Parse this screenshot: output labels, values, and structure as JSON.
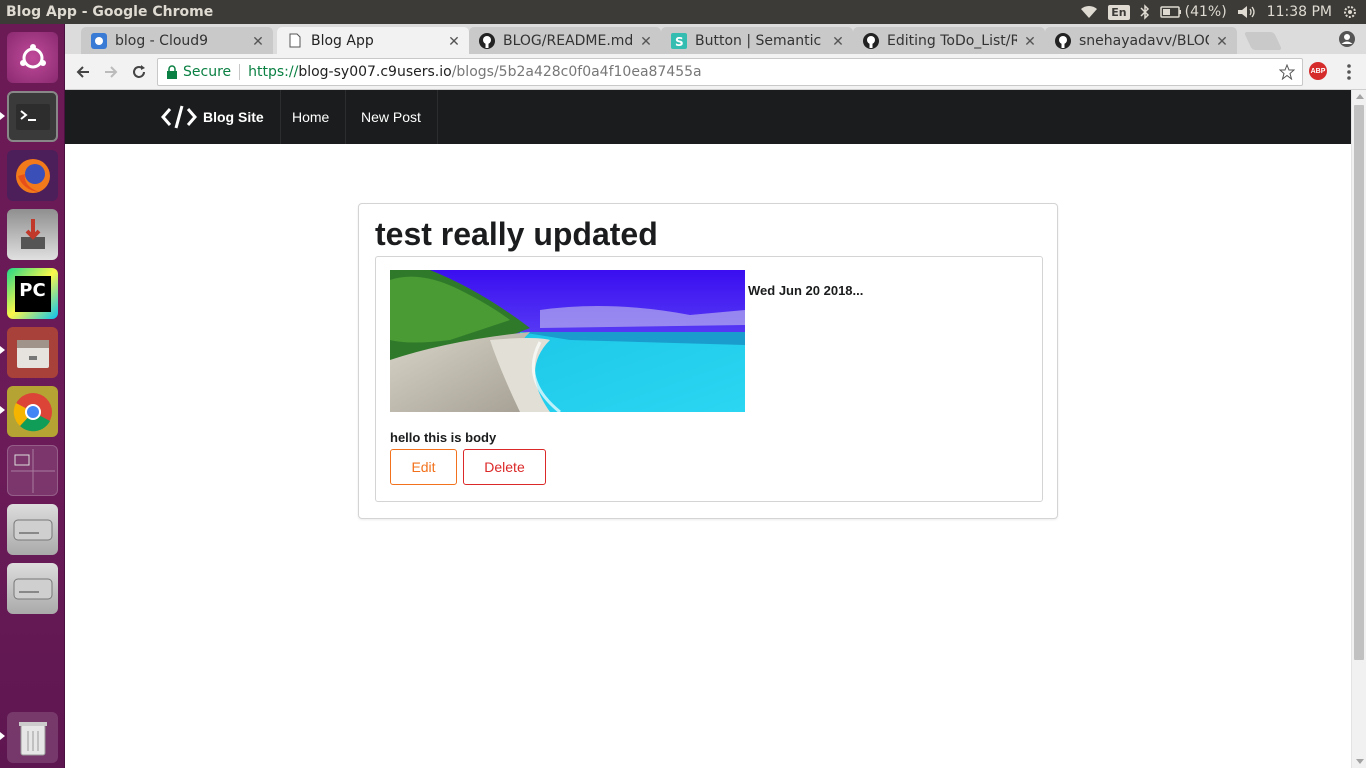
{
  "os": {
    "window_title": "Blog App - Google Chrome",
    "keyboard_layout": "En",
    "battery": "(41%)",
    "clock": "11:38 PM",
    "launcher_items": [
      "ubuntu-home",
      "terminal",
      "firefox",
      "installer",
      "pycharm",
      "files",
      "chrome",
      "workspace-switcher",
      "drive",
      "drive",
      "trash"
    ]
  },
  "browser": {
    "tabs": [
      {
        "label": "blog - Cloud9",
        "icon": "cloud9-icon"
      },
      {
        "label": "Blog App",
        "icon": "page-icon",
        "active": true
      },
      {
        "label": "BLOG/README.md",
        "icon": "github-icon"
      },
      {
        "label": "Button | Semantic UI",
        "icon": "semantic-ui-icon"
      },
      {
        "label": "Editing ToDo_List/R",
        "icon": "github-icon"
      },
      {
        "label": "snehayadavv/BLOG",
        "icon": "github-icon"
      }
    ],
    "secure_label": "Secure",
    "url_scheme": "https://",
    "url_host": "blog-sy007.c9users.io",
    "url_path": "/blogs/5b2a428c0f0a4f10ea87455a",
    "abp_label": "ABP"
  },
  "site": {
    "brand": "Blog Site",
    "nav": [
      "Home",
      "New Post"
    ]
  },
  "post": {
    "title": "test really updated",
    "date": "Wed Jun 20 2018...",
    "body": "hello this is body",
    "edit_label": "Edit",
    "delete_label": "Delete"
  },
  "colors": {
    "edit": "#f2711c",
    "delete": "#db2828",
    "navbar": "#1b1c1d",
    "launcher": "#6b1a55"
  }
}
